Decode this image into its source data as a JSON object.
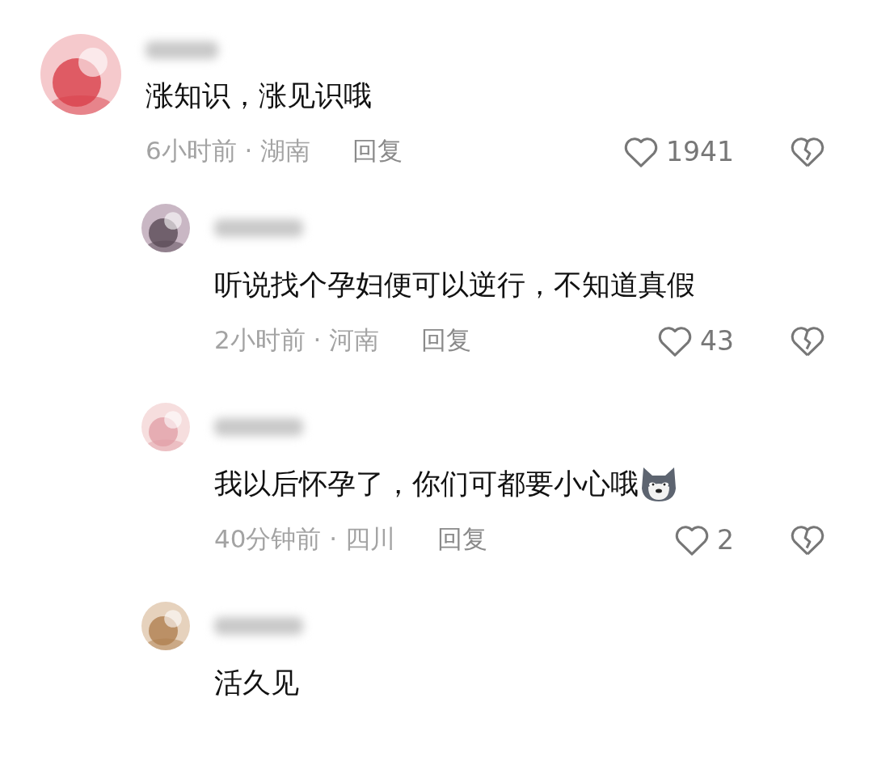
{
  "comments": [
    {
      "kind": "top",
      "text": "涨知识，涨见识哦",
      "emoji": false,
      "meta": "6小时前 · 湖南",
      "reply": "回复",
      "likes": "1941"
    },
    {
      "kind": "reply",
      "text": "听说找个孕妇便可以逆行，不知道真假",
      "emoji": false,
      "meta": "2小时前 · 河南",
      "reply": "回复",
      "likes": "43"
    },
    {
      "kind": "reply",
      "text": "我以后怀孕了，你们可都要小心哦",
      "emoji": true,
      "meta": "40分钟前 · 四川",
      "reply": "回复",
      "likes": "2"
    },
    {
      "kind": "reply",
      "text": "活久见",
      "emoji": false
    }
  ]
}
